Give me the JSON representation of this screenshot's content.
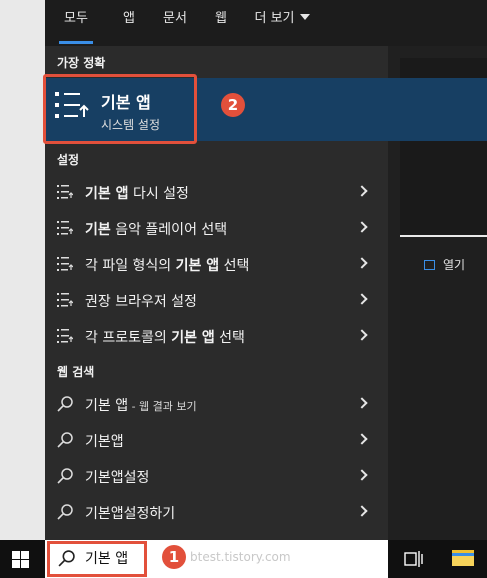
{
  "tabs": [
    "모두",
    "앱",
    "문서",
    "웹",
    "더 보기"
  ],
  "best_match": {
    "section": "가장 정확",
    "title": "기본 앱",
    "subtitle": "시스템 설정",
    "badge": "2"
  },
  "settings_section": "설정",
  "settings_items": [
    {
      "pre": "",
      "bold": "기본 앱",
      "post": " 다시 설정"
    },
    {
      "pre": "",
      "bold": "기본",
      "post": " 음악 플레이어 선택"
    },
    {
      "pre": "각 파일 형식의 ",
      "bold": "기본 앱",
      "post": " 선택"
    },
    {
      "pre": "권장 브라우저 설정",
      "bold": "",
      "post": ""
    },
    {
      "pre": "각 프로토콜의 ",
      "bold": "기본 앱",
      "post": " 선택"
    }
  ],
  "web_section": "웹 검색",
  "web_items": [
    {
      "main": "기본 앱",
      "sub": " - 웹 결과 보기"
    },
    {
      "main": "기본앱",
      "sub": ""
    },
    {
      "main": "기본앱설정",
      "sub": ""
    },
    {
      "main": "기본앱설정하기",
      "sub": ""
    }
  ],
  "right_panel": {
    "open_label": "열기",
    "open_icon": "open-icon"
  },
  "taskbar": {
    "search_value": "기본 앱",
    "badge": "1",
    "watermark": "btest.tistory.com"
  },
  "colors": {
    "accent": "#3a8ee6",
    "highlight": "#e2503b",
    "selected_bg": "#173f63"
  }
}
